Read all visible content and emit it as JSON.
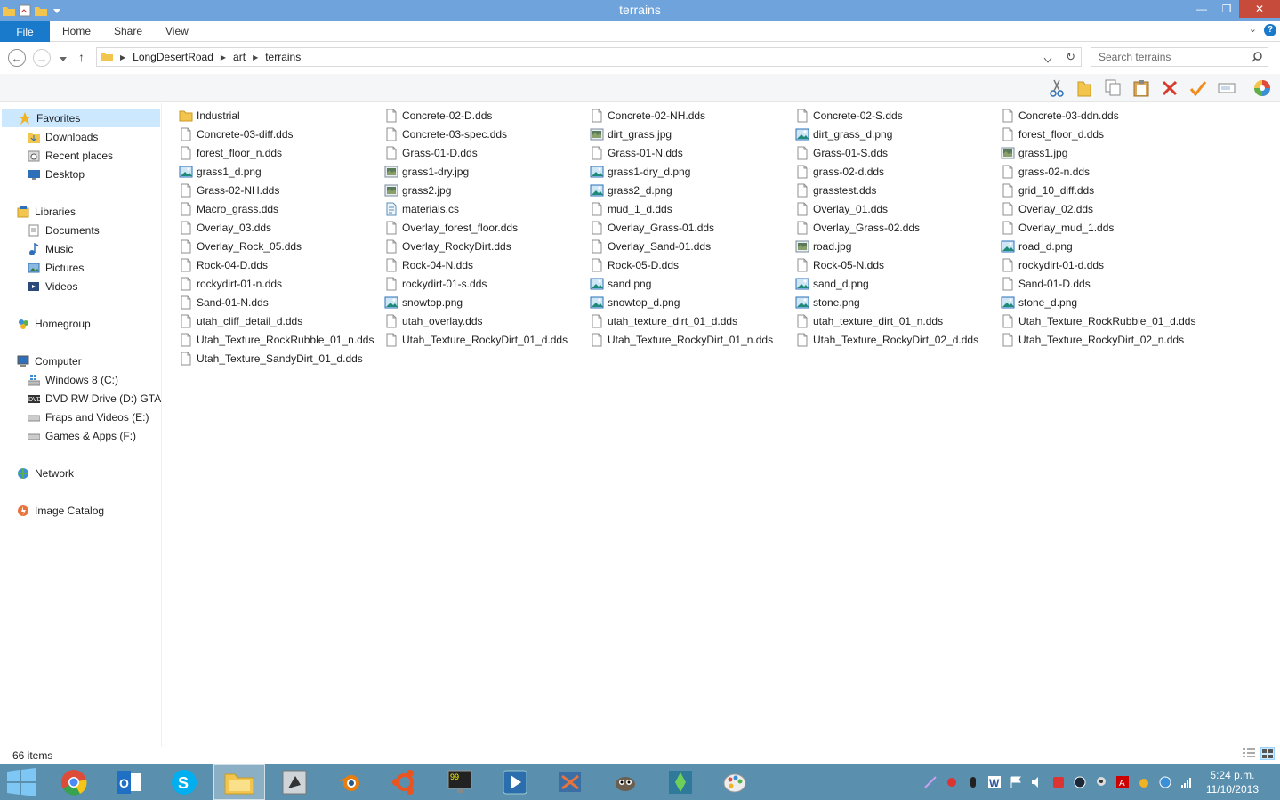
{
  "window": {
    "title": "terrains"
  },
  "ribbon": {
    "file": "File",
    "tabs": [
      "Home",
      "Share",
      "View"
    ],
    "help": "?"
  },
  "address": {
    "crumbs": [
      "LongDesertRoad",
      "art",
      "terrains"
    ],
    "search_placeholder": "Search terrains"
  },
  "nav": {
    "favorites": {
      "label": "Favorites",
      "items": [
        "Downloads",
        "Recent places",
        "Desktop"
      ]
    },
    "libraries": {
      "label": "Libraries",
      "items": [
        "Documents",
        "Music",
        "Pictures",
        "Videos"
      ]
    },
    "homegroup": "Homegroup",
    "computer": {
      "label": "Computer",
      "items": [
        "Windows 8 (C:)",
        "DVD RW Drive (D:) GTA I",
        "Fraps and Videos (E:)",
        "Games & Apps (F:)"
      ]
    },
    "network": "Network",
    "image_catalog": "Image Catalog"
  },
  "files": [
    {
      "name": "Industrial",
      "type": "folder"
    },
    {
      "name": "Concrete-02-D.dds",
      "type": "doc"
    },
    {
      "name": "Concrete-02-NH.dds",
      "type": "doc"
    },
    {
      "name": "Concrete-02-S.dds",
      "type": "doc"
    },
    {
      "name": "Concrete-03-ddn.dds",
      "type": "doc"
    },
    {
      "name": "Concrete-03-diff.dds",
      "type": "doc"
    },
    {
      "name": "Concrete-03-spec.dds",
      "type": "doc"
    },
    {
      "name": "dirt_grass.jpg",
      "type": "jpg"
    },
    {
      "name": "dirt_grass_d.png",
      "type": "png"
    },
    {
      "name": "forest_floor_d.dds",
      "type": "doc"
    },
    {
      "name": "forest_floor_n.dds",
      "type": "doc"
    },
    {
      "name": "Grass-01-D.dds",
      "type": "doc"
    },
    {
      "name": "Grass-01-N.dds",
      "type": "doc"
    },
    {
      "name": "Grass-01-S.dds",
      "type": "doc"
    },
    {
      "name": "grass1.jpg",
      "type": "jpg"
    },
    {
      "name": "grass1_d.png",
      "type": "png"
    },
    {
      "name": "grass1-dry.jpg",
      "type": "jpg"
    },
    {
      "name": "grass1-dry_d.png",
      "type": "png"
    },
    {
      "name": "grass-02-d.dds",
      "type": "doc"
    },
    {
      "name": "grass-02-n.dds",
      "type": "doc"
    },
    {
      "name": "Grass-02-NH.dds",
      "type": "doc"
    },
    {
      "name": "grass2.jpg",
      "type": "jpg"
    },
    {
      "name": "grass2_d.png",
      "type": "png"
    },
    {
      "name": "grasstest.dds",
      "type": "doc"
    },
    {
      "name": "grid_10_diff.dds",
      "type": "doc"
    },
    {
      "name": "Macro_grass.dds",
      "type": "doc"
    },
    {
      "name": "materials.cs",
      "type": "cs"
    },
    {
      "name": "mud_1_d.dds",
      "type": "doc"
    },
    {
      "name": "Overlay_01.dds",
      "type": "doc"
    },
    {
      "name": "Overlay_02.dds",
      "type": "doc"
    },
    {
      "name": "Overlay_03.dds",
      "type": "doc"
    },
    {
      "name": "Overlay_forest_floor.dds",
      "type": "doc"
    },
    {
      "name": "Overlay_Grass-01.dds",
      "type": "doc"
    },
    {
      "name": "Overlay_Grass-02.dds",
      "type": "doc"
    },
    {
      "name": "Overlay_mud_1.dds",
      "type": "doc"
    },
    {
      "name": "Overlay_Rock_05.dds",
      "type": "doc"
    },
    {
      "name": "Overlay_RockyDirt.dds",
      "type": "doc"
    },
    {
      "name": "Overlay_Sand-01.dds",
      "type": "doc"
    },
    {
      "name": "road.jpg",
      "type": "jpg"
    },
    {
      "name": "road_d.png",
      "type": "png"
    },
    {
      "name": "Rock-04-D.dds",
      "type": "doc"
    },
    {
      "name": "Rock-04-N.dds",
      "type": "doc"
    },
    {
      "name": "Rock-05-D.dds",
      "type": "doc"
    },
    {
      "name": "Rock-05-N.dds",
      "type": "doc"
    },
    {
      "name": "rockydirt-01-d.dds",
      "type": "doc"
    },
    {
      "name": "rockydirt-01-n.dds",
      "type": "doc"
    },
    {
      "name": "rockydirt-01-s.dds",
      "type": "doc"
    },
    {
      "name": "sand.png",
      "type": "png"
    },
    {
      "name": "sand_d.png",
      "type": "png"
    },
    {
      "name": "Sand-01-D.dds",
      "type": "doc"
    },
    {
      "name": "Sand-01-N.dds",
      "type": "doc"
    },
    {
      "name": "snowtop.png",
      "type": "png"
    },
    {
      "name": "snowtop_d.png",
      "type": "png"
    },
    {
      "name": "stone.png",
      "type": "png"
    },
    {
      "name": "stone_d.png",
      "type": "png"
    },
    {
      "name": "utah_cliff_detail_d.dds",
      "type": "doc"
    },
    {
      "name": "utah_overlay.dds",
      "type": "doc"
    },
    {
      "name": "utah_texture_dirt_01_d.dds",
      "type": "doc"
    },
    {
      "name": "utah_texture_dirt_01_n.dds",
      "type": "doc"
    },
    {
      "name": "Utah_Texture_RockRubble_01_d.dds",
      "type": "doc"
    },
    {
      "name": "Utah_Texture_RockRubble_01_n.dds",
      "type": "doc"
    },
    {
      "name": "Utah_Texture_RockyDirt_01_d.dds",
      "type": "doc"
    },
    {
      "name": "Utah_Texture_RockyDirt_01_n.dds",
      "type": "doc"
    },
    {
      "name": "Utah_Texture_RockyDirt_02_d.dds",
      "type": "doc"
    },
    {
      "name": "Utah_Texture_RockyDirt_02_n.dds",
      "type": "doc"
    },
    {
      "name": "Utah_Texture_SandyDirt_01_d.dds",
      "type": "doc"
    }
  ],
  "status": {
    "count": "66 items"
  },
  "taskbar": {
    "apps": [
      "chrome-icon",
      "outlook-icon",
      "skype-icon",
      "explorer-icon",
      "game-icon",
      "blender-icon",
      "ubuntu-icon",
      "monitor-icon",
      "media-player-icon",
      "video-editor-icon",
      "gimp-icon",
      "sims-icon",
      "paint-icon"
    ],
    "time": "5:24 p.m.",
    "date": "11/10/2013"
  },
  "colors": {
    "titlebar": "#6ea3dc",
    "file_tab": "#1979ca",
    "selection": "#cce8ff",
    "taskbar": "#5a8fae",
    "close": "#c74b3b"
  }
}
